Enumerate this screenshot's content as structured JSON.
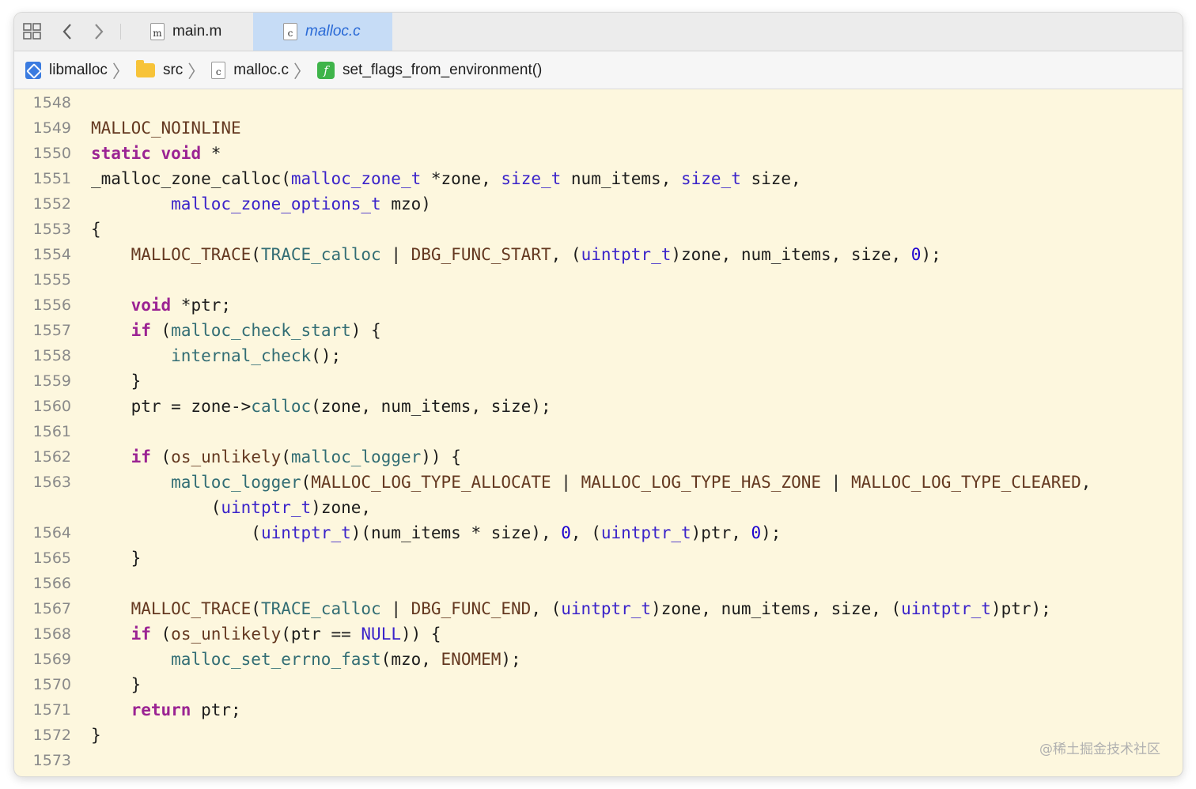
{
  "tabs": {
    "main_label": "main.m",
    "main_icon_letter": "m",
    "malloc_label": "malloc.c",
    "malloc_icon_letter": "c"
  },
  "breadcrumb": {
    "project": "libmalloc",
    "folder": "src",
    "file": "malloc.c",
    "file_icon_letter": "c",
    "function": "set_flags_from_environment()",
    "function_icon_letter": "f"
  },
  "line_numbers": [
    "1548",
    "1549",
    "1550",
    "1551",
    "1552",
    "1553",
    "1554",
    "1555",
    "1556",
    "1557",
    "1558",
    "1559",
    "1560",
    "1561",
    "1562",
    "1563",
    "",
    "1564",
    "1565",
    "1566",
    "1567",
    "1568",
    "1569",
    "1570",
    "1571",
    "1572",
    "1573"
  ],
  "code_tokens": {
    "macro_noinline": "MALLOC_NOINLINE",
    "kw_static": "static",
    "kw_void": "void",
    "kw_if": "if",
    "kw_return": "return",
    "fn_zone_calloc": "_malloc_zone_calloc",
    "ty_malloc_zone_t": "malloc_zone_t",
    "ty_size_t": "size_t",
    "ty_zone_options": "malloc_zone_options_t",
    "ty_uintptr_t": "uintptr_t",
    "mac_trace": "MALLOC_TRACE",
    "fn_trace_calloc": "TRACE_calloc",
    "mac_func_start": "DBG_FUNC_START",
    "mac_func_end": "DBG_FUNC_END",
    "fn_check_start": "malloc_check_start",
    "fn_internal_check": "internal_check",
    "fn_calloc": "calloc",
    "fn_os_unlikely": "os_unlikely",
    "fn_malloc_logger": "malloc_logger",
    "mac_type_allocate": "MALLOC_LOG_TYPE_ALLOCATE",
    "mac_type_has_zone": "MALLOC_LOG_TYPE_HAS_ZONE",
    "mac_type_cleared": "MALLOC_LOG_TYPE_CLEARED",
    "mac_null": "NULL",
    "fn_set_errno": "malloc_set_errno_fast",
    "mac_enomem": "ENOMEM",
    "num_zero": "0"
  },
  "watermark": "@稀土掘金技术社区",
  "colors": {
    "editor_bg": "#fdf7de",
    "keyword": "#9b2393",
    "type": "#3a23c9",
    "function": "#326d74",
    "macro": "#643820",
    "number": "#1c00cf",
    "active_tab": "#c6dcf6"
  }
}
